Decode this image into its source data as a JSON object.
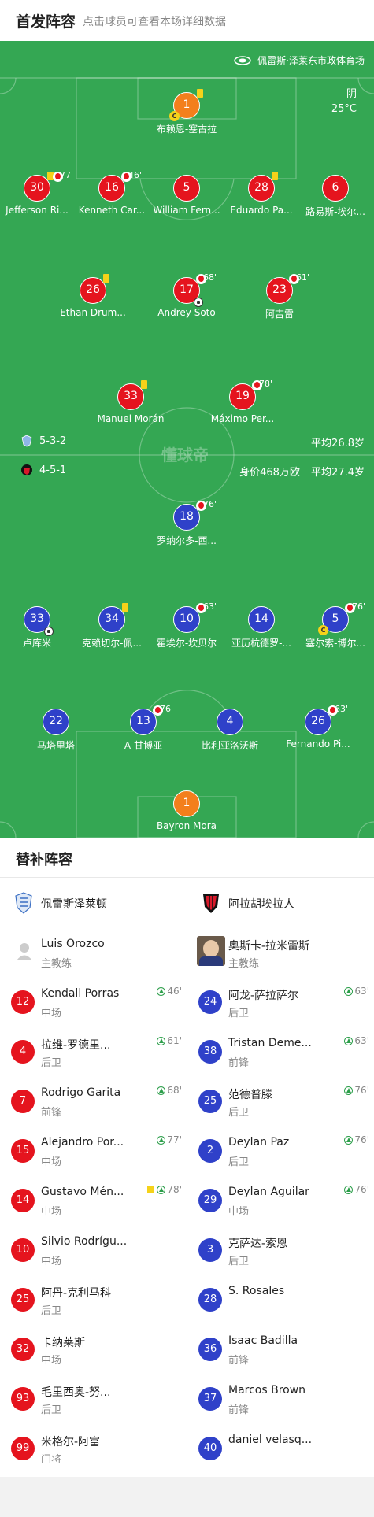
{
  "header": {
    "title": "首发阵容",
    "hint": "点击球员可查看本场详细数据"
  },
  "pitch": {
    "venue": "佩雷斯·泽莱东市政体育场",
    "weather": "阴",
    "temperature": "25°C",
    "watermark": "懂球帝",
    "home": {
      "formation": "5-3-2",
      "avg_age": "平均26.8岁",
      "market_value": ""
    },
    "away": {
      "formation": "4-5-1",
      "market_value": "身价468万欧",
      "avg_age": "平均27.4岁"
    },
    "home_players": [
      {
        "num": "1",
        "name": "布赖恩-塞古拉",
        "color": "orange",
        "yc": true,
        "cap": true
      },
      {
        "num": "30",
        "name": "Jefferson Ri...",
        "color": "red",
        "yc": true,
        "sub": "77'"
      },
      {
        "num": "16",
        "name": "Kenneth Car...",
        "color": "red",
        "sub": "46'"
      },
      {
        "num": "5",
        "name": "William Fern...",
        "color": "red"
      },
      {
        "num": "28",
        "name": "Eduardo Pa...",
        "color": "red",
        "yc": true
      },
      {
        "num": "6",
        "name": "路易斯-埃尔...",
        "color": "red"
      },
      {
        "num": "26",
        "name": "Ethan Drum...",
        "color": "red",
        "yc": true
      },
      {
        "num": "17",
        "name": "Andrey Soto",
        "color": "red",
        "sub": "68'",
        "goal": true
      },
      {
        "num": "23",
        "name": "阿吉雷",
        "color": "red",
        "sub": "61'"
      },
      {
        "num": "33",
        "name": "Manuel Morán",
        "color": "red",
        "yc": true
      },
      {
        "num": "19",
        "name": "Máximo Per...",
        "color": "red",
        "sub": "78'"
      }
    ],
    "away_players": [
      {
        "num": "18",
        "name": "罗纳尔多-西...",
        "color": "blue",
        "sub": "76'"
      },
      {
        "num": "33",
        "name": "卢库米",
        "color": "blue",
        "goal": true
      },
      {
        "num": "34",
        "name": "克赖切尔-佩...",
        "color": "blue",
        "yc": true
      },
      {
        "num": "10",
        "name": "霍埃尔-坎贝尔",
        "color": "blue",
        "sub": "63'"
      },
      {
        "num": "14",
        "name": "亚历杭德罗-...",
        "color": "blue"
      },
      {
        "num": "5",
        "name": "塞尔索-博尔...",
        "color": "blue",
        "sub": "76'",
        "cap": true
      },
      {
        "num": "22",
        "name": "马塔里塔",
        "color": "blue"
      },
      {
        "num": "13",
        "name": "A-甘博亚",
        "color": "blue",
        "sub": "76'"
      },
      {
        "num": "4",
        "name": "比利亚洛沃斯",
        "color": "blue"
      },
      {
        "num": "26",
        "name": "Fernando Pi...",
        "color": "blue",
        "sub": "63'"
      },
      {
        "num": "1",
        "name": "Bayron Mora",
        "color": "orange"
      }
    ]
  },
  "subs": {
    "title": "替补阵容",
    "home": {
      "team": "佩雷斯泽莱顿",
      "coach": {
        "name": "Luis Orozco",
        "role": "主教练"
      },
      "players": [
        {
          "num": "12",
          "name": "Kendall Porras",
          "pos": "中场",
          "in": "46'"
        },
        {
          "num": "4",
          "name": "拉维-罗德里...",
          "pos": "后卫",
          "in": "61'"
        },
        {
          "num": "7",
          "name": "Rodrigo Garita",
          "pos": "前锋",
          "in": "68'"
        },
        {
          "num": "15",
          "name": "Alejandro Por...",
          "pos": "中场",
          "in": "77'"
        },
        {
          "num": "14",
          "name": "Gustavo Mén...",
          "pos": "中场",
          "in": "78'",
          "yc": true
        },
        {
          "num": "10",
          "name": "Silvio Rodrígu...",
          "pos": "中场",
          "in": ""
        },
        {
          "num": "25",
          "name": "阿丹-克利马科",
          "pos": "后卫",
          "in": ""
        },
        {
          "num": "32",
          "name": "卡纳莱斯",
          "pos": "中场",
          "in": ""
        },
        {
          "num": "93",
          "name": "毛里西奥-努...",
          "pos": "后卫",
          "in": ""
        },
        {
          "num": "99",
          "name": "米格尔-阿富",
          "pos": "门将",
          "in": ""
        }
      ]
    },
    "away": {
      "team": "阿拉胡埃拉人",
      "coach": {
        "name": "奥斯卡-拉米雷斯",
        "role": "主教练"
      },
      "players": [
        {
          "num": "24",
          "name": "阿龙-萨拉萨尔",
          "pos": "后卫",
          "in": "63'"
        },
        {
          "num": "38",
          "name": "Tristan Deme...",
          "pos": "前锋",
          "in": "63'"
        },
        {
          "num": "25",
          "name": "范德普滕",
          "pos": "后卫",
          "in": "76'"
        },
        {
          "num": "2",
          "name": "Deylan Paz",
          "pos": "后卫",
          "in": "76'"
        },
        {
          "num": "29",
          "name": "Deylan Aguilar",
          "pos": "中场",
          "in": "76'"
        },
        {
          "num": "3",
          "name": "克萨达-索恩",
          "pos": "后卫",
          "in": ""
        },
        {
          "num": "28",
          "name": "S. Rosales",
          "pos": "",
          "in": ""
        },
        {
          "num": "36",
          "name": "Isaac Badilla",
          "pos": "前锋",
          "in": ""
        },
        {
          "num": "37",
          "name": "Marcos Brown",
          "pos": "前锋",
          "in": ""
        },
        {
          "num": "40",
          "name": "daniel velasq...",
          "pos": "",
          "in": ""
        }
      ]
    }
  }
}
